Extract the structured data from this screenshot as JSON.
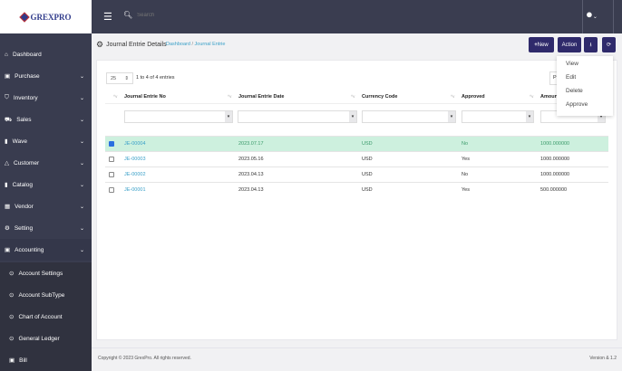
{
  "brand": "GREXPRO",
  "search": {
    "placeholder": "Search"
  },
  "sidebar": {
    "items": [
      {
        "label": "Dashboard",
        "icon": "home-icon",
        "chev": false
      },
      {
        "label": "Purchase",
        "icon": "briefcase-icon",
        "chev": true
      },
      {
        "label": "Inventory",
        "icon": "shield-icon",
        "chev": true
      },
      {
        "label": "Sales",
        "icon": "cart-icon",
        "chev": true
      },
      {
        "label": "Wave",
        "icon": "book-icon",
        "chev": true
      },
      {
        "label": "Customer",
        "icon": "warning-icon",
        "chev": true
      },
      {
        "label": "Catalog",
        "icon": "book-icon",
        "chev": true
      },
      {
        "label": "Vendor",
        "icon": "building-icon",
        "chev": true
      },
      {
        "label": "Setting",
        "icon": "gear-icon",
        "chev": true
      },
      {
        "label": "Accounting",
        "icon": "briefcase-icon",
        "chev": true
      }
    ],
    "subitems": [
      {
        "label": "Account Settings"
      },
      {
        "label": "Account SubType"
      },
      {
        "label": "Chart of Account"
      },
      {
        "label": "General Ledger"
      }
    ],
    "bill": "Bill"
  },
  "page": {
    "title": "Journal Entrie Details",
    "crumb_home": "Dashboard",
    "crumb_sep": "/",
    "crumb_current": "Journal Entrie"
  },
  "toolbar": {
    "new": "New",
    "action": "Action"
  },
  "action_menu": [
    "View",
    "Edit",
    "Delete",
    "Approve"
  ],
  "table": {
    "page_size": "25",
    "info": "1 to 4 of 4 entries",
    "search_partial": "Pr",
    "columns": [
      "Journal Entrie No",
      "Journal Entrie Date",
      "Currency Code",
      "Approved",
      "Amount"
    ],
    "rows": [
      {
        "no": "JE-00004",
        "date": "2023.07.17",
        "cur": "USD",
        "appr": "No",
        "amt": "1000.000000",
        "checked": true
      },
      {
        "no": "JE-00003",
        "date": "2023.05.16",
        "cur": "USD",
        "appr": "Yes",
        "amt": "1000.000000",
        "checked": false
      },
      {
        "no": "JE-00002",
        "date": "2023.04.13",
        "cur": "USD",
        "appr": "No",
        "amt": "1000.000000",
        "checked": false
      },
      {
        "no": "JE-00001",
        "date": "2023.04.13",
        "cur": "USD",
        "appr": "Yes",
        "amt": "500.000000",
        "checked": false
      }
    ]
  },
  "footer": {
    "copyright": "Copyright © 2023 GrexPro. All rights reserved.",
    "version": "Version & 1.2"
  }
}
